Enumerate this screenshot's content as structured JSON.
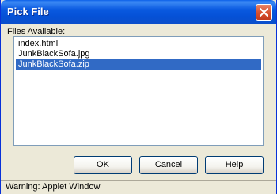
{
  "window": {
    "title": "Pick File"
  },
  "files": {
    "label": "Files Available:",
    "items": [
      "index.html",
      "JunkBlackSofa.jpg",
      "JunkBlackSofa.zip"
    ],
    "selected_index": 2
  },
  "buttons": {
    "ok": "OK",
    "cancel": "Cancel",
    "help": "Help"
  },
  "status": {
    "text": "Warning: Applet Window"
  },
  "colors": {
    "titlebar": "#0551D6",
    "selection": "#316AC5",
    "dialog_bg": "#ECE9D8"
  },
  "icons": {
    "close": "close-icon"
  }
}
